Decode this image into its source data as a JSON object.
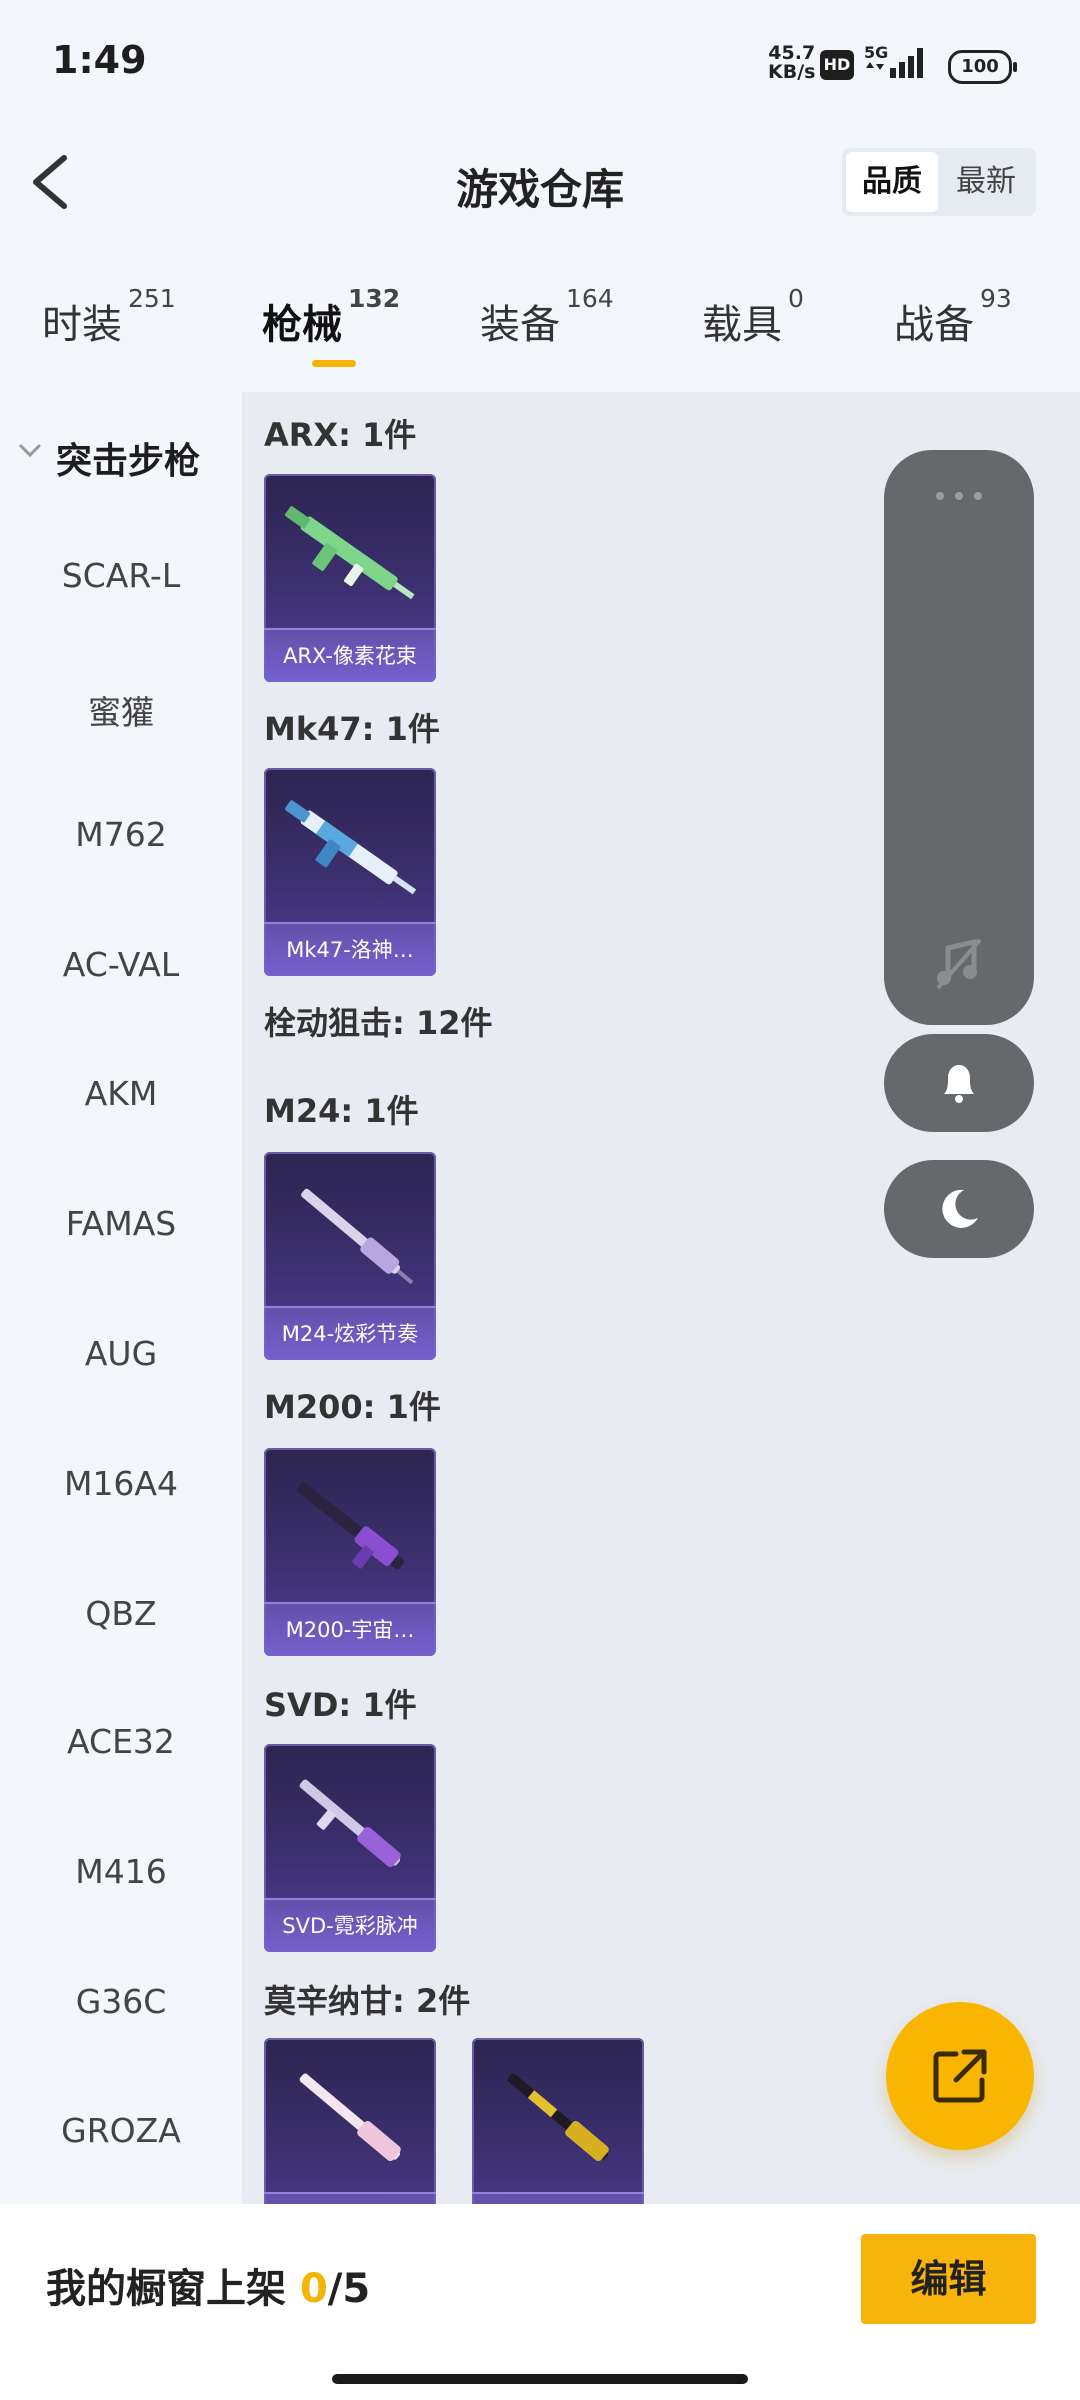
{
  "status_bar": {
    "time": "1:49",
    "net_speed": "45.7",
    "net_unit": "KB/s",
    "hd": "HD",
    "signal": "5G",
    "battery": "100"
  },
  "header": {
    "title": "游戏仓库",
    "sort_options": [
      "品质",
      "最新"
    ]
  },
  "tabs": [
    {
      "label": "时装",
      "count": "251"
    },
    {
      "label": "枪械",
      "count": "132"
    },
    {
      "label": "装备",
      "count": "164"
    },
    {
      "label": "载具",
      "count": "0"
    },
    {
      "label": "战备",
      "count": "93"
    }
  ],
  "sidebar": {
    "category": "突击步枪",
    "items": [
      "SCAR-L",
      "蜜獾",
      "M762",
      "AC-VAL",
      "AKM",
      "FAMAS",
      "AUG",
      "M16A4",
      "QBZ",
      "ACE32",
      "M416",
      "G36C",
      "GROZA"
    ]
  },
  "sections": [
    {
      "title": "ARX: 1件",
      "cards": [
        "ARX-像素花束"
      ]
    },
    {
      "title": "Mk47: 1件",
      "cards": [
        "Mk47-洛神…"
      ]
    },
    {
      "title": "栓动狙击: 12件",
      "cards": []
    },
    {
      "title": "M24: 1件",
      "cards": [
        "M24-炫彩节奏"
      ]
    },
    {
      "title": "M200: 1件",
      "cards": [
        "M200-宇宙…"
      ]
    },
    {
      "title": "SVD: 1件",
      "cards": [
        "SVD-霓彩脉冲"
      ]
    },
    {
      "title": "莫辛纳甘: 2件",
      "cards": [
        "",
        ""
      ]
    }
  ],
  "bottom_bar": {
    "shelf_label": "我的橱窗上架",
    "shelf_current": "0",
    "shelf_total": "/5",
    "edit_label": "编辑"
  },
  "colors": {
    "accent": "#f4b400",
    "card_bg": "#3c3070",
    "float_widget": "#66696c"
  },
  "icons": [
    "back-arrow-icon",
    "chevron-down-icon",
    "more-dots-icon",
    "music-off-icon",
    "bell-icon",
    "moon-icon",
    "share-external-icon"
  ]
}
